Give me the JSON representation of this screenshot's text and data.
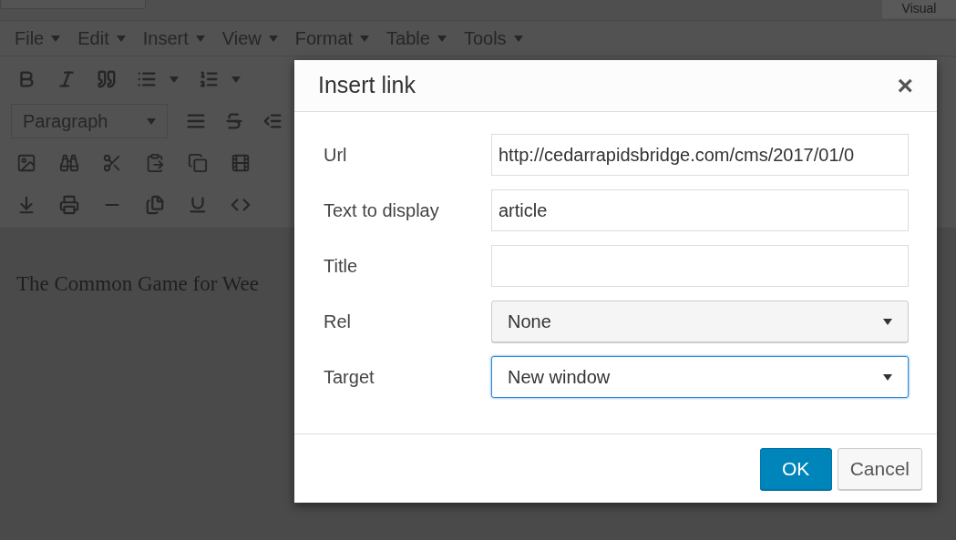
{
  "editor": {
    "visual_tab": "Visual",
    "menus": [
      "File",
      "Edit",
      "Insert",
      "View",
      "Format",
      "Table",
      "Tools"
    ],
    "format_select": "Paragraph",
    "content": "The Common Game for Wee"
  },
  "dialog": {
    "title": "Insert link",
    "close": "×",
    "fields": [
      {
        "kind": "text",
        "label": "Url",
        "value": "http://cedarrapidsbridge.com/cms/2017/01/0",
        "focused": false
      },
      {
        "kind": "text",
        "label": "Text to display",
        "value": "article",
        "focused": false
      },
      {
        "kind": "text",
        "label": "Title",
        "focused": false
      },
      {
        "kind": "select",
        "label": "Rel",
        "value": "None",
        "focused": false
      },
      {
        "kind": "select",
        "label": "Target",
        "value": "New window",
        "focused": true
      }
    ],
    "buttons": [
      {
        "label": "OK",
        "primary": true
      },
      {
        "label": "Cancel",
        "primary": false
      }
    ]
  }
}
